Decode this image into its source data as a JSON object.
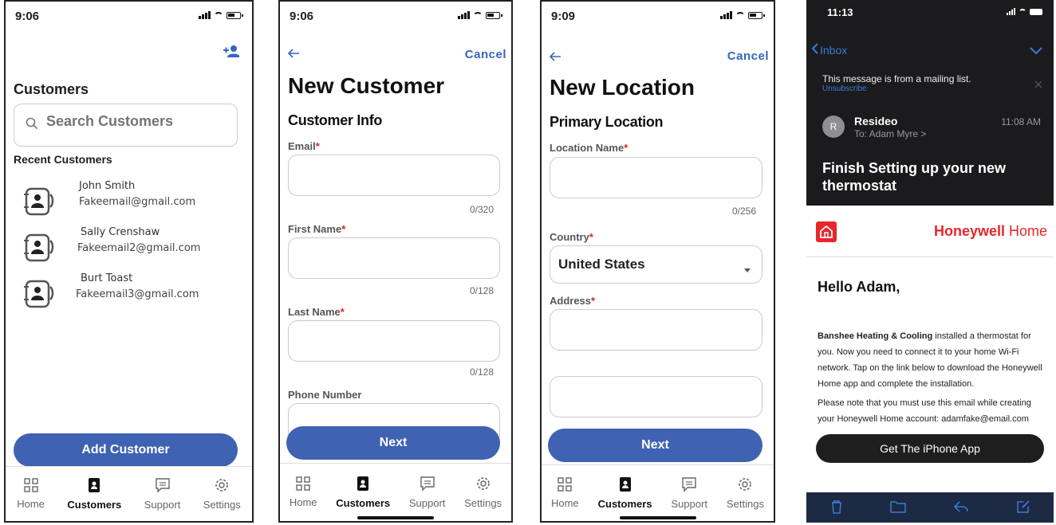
{
  "phone1": {
    "time": "9:06",
    "title": "Customers",
    "search_placeholder": "Search Customers",
    "recent_heading": "Recent Customers",
    "customers": [
      {
        "name": "John Smith",
        "email": "Fakeemail@gmail.com"
      },
      {
        "name": "Sally Crenshaw",
        "email": "Fakeemail2@gmail.com"
      },
      {
        "name": "Burt Toast",
        "email": "Fakeemail3@gmail.com"
      }
    ],
    "add_button": "Add Customer"
  },
  "phone2": {
    "time": "9:06",
    "cancel": "Cancel",
    "title": "New Customer",
    "section": "Customer Info",
    "email_label": "Email",
    "email_counter": "0/320",
    "first_name_label": "First Name",
    "first_counter": "0/128",
    "last_name_label": "Last Name",
    "last_counter": "0/128",
    "phone_label": "Phone Number",
    "next": "Next"
  },
  "phone3": {
    "time": "9:09",
    "cancel": "Cancel",
    "title": "New Location",
    "section": "Primary Location",
    "location_label": "Location Name",
    "location_counter": "0/256",
    "country_label": "Country",
    "country_value": "United States",
    "address_label": "Address",
    "next": "Next"
  },
  "tabs": {
    "home": "Home",
    "customers": "Customers",
    "support": "Support",
    "settings": "Settings"
  },
  "phone4": {
    "time": "11:13",
    "back": "Inbox",
    "mailing_notice": "This message is from a mailing list.",
    "unsubscribe": "Unsubscribe",
    "sender": "Resideo",
    "sender_initial": "R",
    "sent_time": "11:08 AM",
    "to": "To: Adam Myre >",
    "subject": "Finish Setting up your new thermostat",
    "brand_bold": "Honeywell",
    "brand_light": " Home",
    "greeting": "Hello Adam,",
    "para1_bold": "Banshee Heating & Cooling",
    "para1_rest": " installed a thermostat for you. Now you need to connect it to your home Wi-Fi network. Tap on the link below to download the Honeywell Home app and complete the installation.",
    "para2": "Please note that you must use this email while creating your Honeywell Home account: adamfake@email.com",
    "cta": "Get The iPhone App"
  },
  "colors": {
    "accent": "#3f62b2",
    "link": "#3565c2",
    "required": "#d22222",
    "honeywell_red": "#e8262b",
    "mail_dark": "#1b1b1d",
    "mail_toolbar": "#1c2a44"
  }
}
